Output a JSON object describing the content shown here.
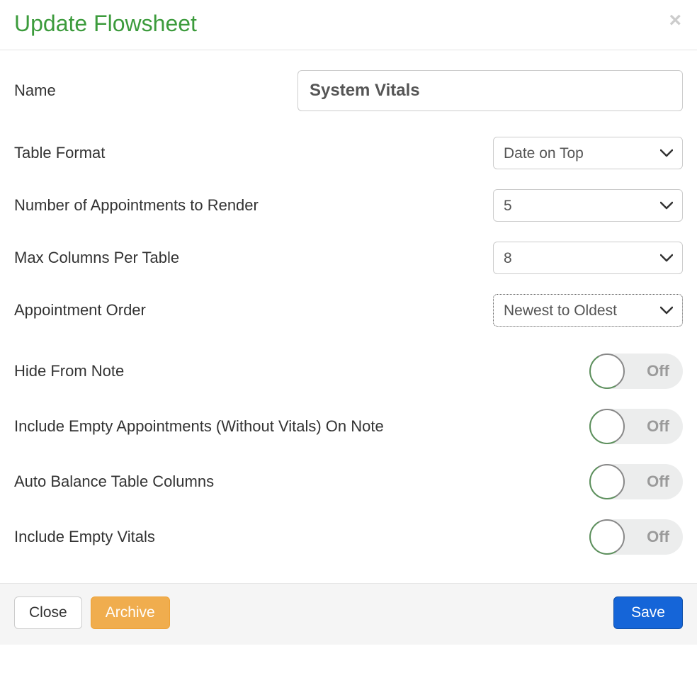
{
  "header": {
    "title": "Update Flowsheet",
    "close_glyph": "×"
  },
  "form": {
    "name": {
      "label": "Name",
      "value": "System Vitals"
    },
    "table_format": {
      "label": "Table Format",
      "value": "Date on Top"
    },
    "num_appointments": {
      "label": "Number of Appointments to Render",
      "value": "5"
    },
    "max_columns": {
      "label": "Max Columns Per Table",
      "value": "8"
    },
    "appt_order": {
      "label": "Appointment Order",
      "value": "Newest to Oldest"
    },
    "hide_from_note": {
      "label": "Hide From Note",
      "state_label": "Off"
    },
    "include_empty_appts": {
      "label": "Include Empty Appointments (Without Vitals) On Note",
      "state_label": "Off"
    },
    "auto_balance": {
      "label": "Auto Balance Table Columns",
      "state_label": "Off"
    },
    "include_empty_vitals": {
      "label": "Include Empty Vitals",
      "state_label": "Off"
    }
  },
  "footer": {
    "close": "Close",
    "archive": "Archive",
    "save": "Save"
  }
}
